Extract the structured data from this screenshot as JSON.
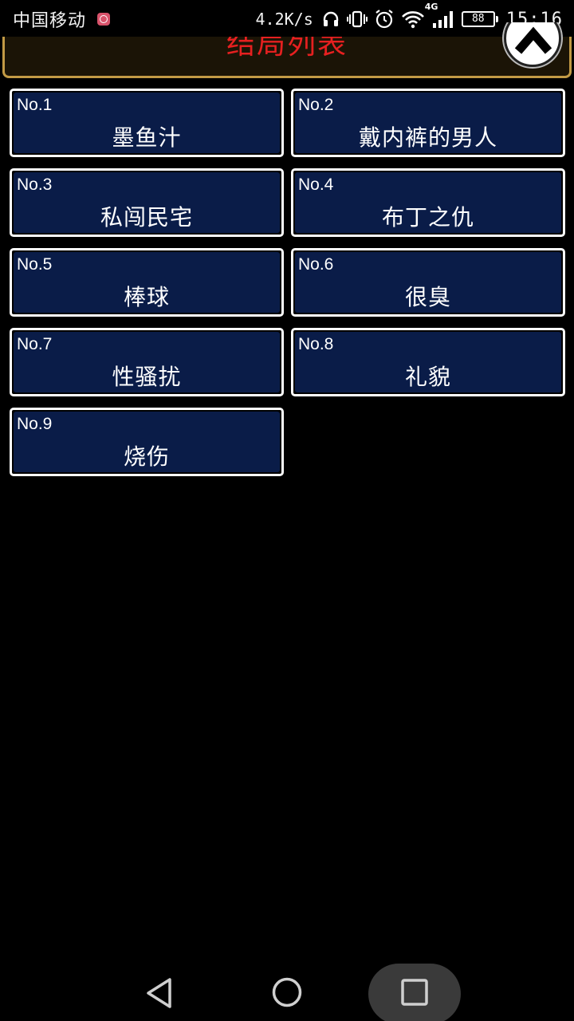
{
  "status_bar": {
    "carrier": "中国移动",
    "net_speed": "4.2K/s",
    "network_type": "4G",
    "battery": "88",
    "time": "15:16"
  },
  "header": {
    "title": "结局列表"
  },
  "endings": [
    {
      "no": "No.1",
      "title": "墨鱼汁"
    },
    {
      "no": "No.2",
      "title": "戴内裤的男人"
    },
    {
      "no": "No.3",
      "title": "私闯民宅"
    },
    {
      "no": "No.4",
      "title": "布丁之仇"
    },
    {
      "no": "No.5",
      "title": "棒球"
    },
    {
      "no": "No.6",
      "title": "很臭"
    },
    {
      "no": "No.7",
      "title": "性骚扰"
    },
    {
      "no": "No.8",
      "title": "礼貌"
    },
    {
      "no": "No.9",
      "title": "烧伤"
    }
  ],
  "icons": {
    "notification": "app-notification-icon",
    "headphones": "headphones-icon",
    "vibrate": "vibrate-icon",
    "alarm": "alarm-icon",
    "wifi": "wifi-icon",
    "signal": "signal-icon",
    "close": "chevron-up-icon",
    "back": "back-icon",
    "home": "home-icon",
    "recent": "recent-apps-icon"
  },
  "colors": {
    "card_bg": "#0a1c48",
    "header_border": "#c29a45",
    "header_title": "#e62020"
  }
}
